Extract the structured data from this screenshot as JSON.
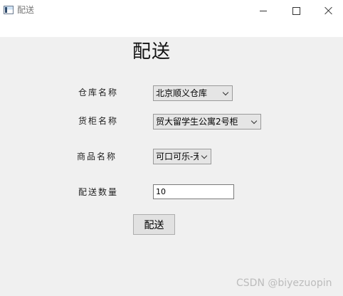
{
  "window": {
    "title": "配送"
  },
  "form": {
    "heading": "配送",
    "warehouse_label": "仓库名称",
    "warehouse_value": "北京顺义仓库",
    "cabinet_label": "货柜名称",
    "cabinet_value": "贸大留学生公寓2号柜",
    "goods_label": "商品名称",
    "goods_value": "可口可乐-无糖",
    "quantity_label": "配送数量",
    "quantity_value": "10",
    "submit_label": "配送"
  },
  "watermark": "CSDN @biyezuopin",
  "icons": {
    "app": "app-window-icon",
    "minimize": "minimize-icon",
    "maximize": "maximize-icon",
    "close": "close-icon",
    "dropdown": "chevron-down-icon"
  }
}
